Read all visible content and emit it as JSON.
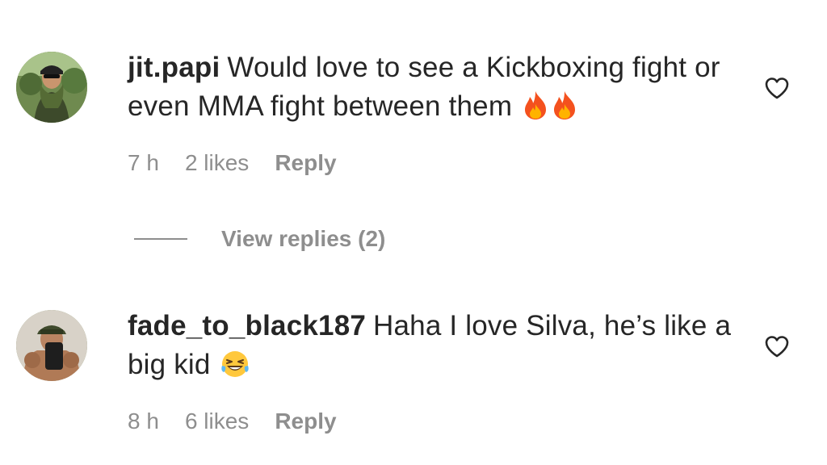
{
  "comments": [
    {
      "username": "jit.papi",
      "text": "Would love to see a Kickboxing fight or even MMA fight between them",
      "emoji": "fire-fire",
      "time": "7 h",
      "likes": "2 likes",
      "reply_label": "Reply"
    },
    {
      "username": "fade_to_black187",
      "text": "Haha I love Silva, he’s like a big kid",
      "emoji": "laughing-face",
      "time": "8 h",
      "likes": "6 likes",
      "reply_label": "Reply"
    }
  ],
  "view_replies": {
    "label": "View replies (2)"
  },
  "colors": {
    "text": "#262626",
    "muted": "#8e8e8e",
    "background": "#ffffff"
  },
  "icons": {
    "like": "heart-outline-icon"
  }
}
